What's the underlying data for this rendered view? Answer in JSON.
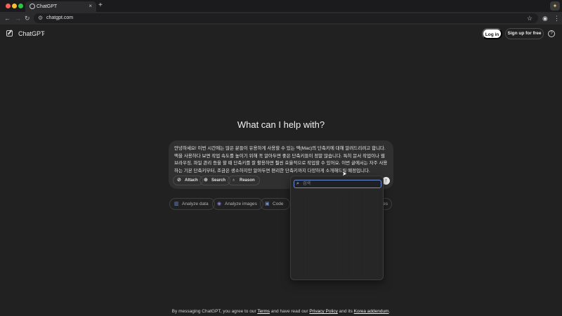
{
  "browser": {
    "tab_title": "ChatGPT",
    "tab_close": "×",
    "new_tab": "+",
    "url": "chatgpt.com",
    "back": "←",
    "forward": "→",
    "reload": "↻"
  },
  "header": {
    "brand": "ChatGPT",
    "login_label": "Log in",
    "signup_label": "Sign up for free",
    "help_label": "?"
  },
  "hero": {
    "title": "What can I help with?"
  },
  "composer": {
    "text": "안녕하세요! 이번 시간에는 많은 분들이 유용하게 사용할 수 있는 맥(Mac)의 단축키에 대해 알려드리려고 합니다. 맥을 사용하다 보면 작업 속도를 높이기 위해 꼭 알아두면 좋은 단축키들이 정말 많습니다. 특히 문서 작업이나 웹 브라우징, 파일 관리 등을 할 때 단축키를 잘 활용하면 훨씬 효율적으로 작업할 수 있어요. 이번 글에서는 자주 사용하는 기본 단축키부터, 조금은 생소하지만 알아두면 편리한 단축키까지 다양하게 소개해드릴 예정입니다.",
    "attach_label": "Attach",
    "search_label": "Search",
    "reason_label": "Reason"
  },
  "suggestions": [
    {
      "label": "Analyze data",
      "icon": "chart-icon",
      "color": "#6d8fd6"
    },
    {
      "label": "Analyze images",
      "icon": "eye-icon",
      "color": "#8f7bd6"
    },
    {
      "label": "Code",
      "icon": "code-icon",
      "color": "#6d8fd6"
    }
  ],
  "suggestion_more": "res",
  "popup": {
    "search_placeholder": "검색"
  },
  "footer": {
    "prefix": "By messaging ChatGPT, you agree to our ",
    "terms": "Terms",
    "middle": " and have read our ",
    "privacy": "Privacy Policy",
    "and_its": " and its ",
    "addendum": "Korea addendum",
    "suffix": "."
  }
}
